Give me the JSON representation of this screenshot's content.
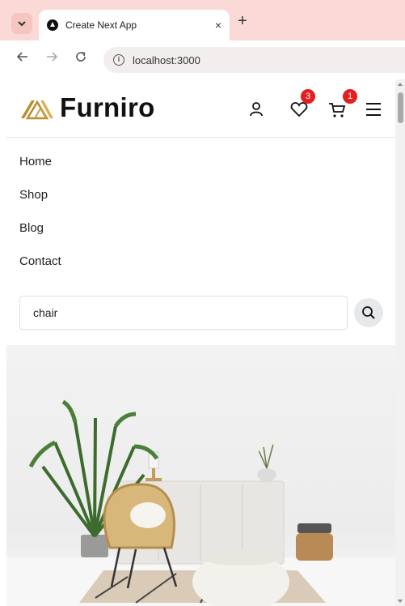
{
  "browser": {
    "tab_title": "Create Next App",
    "tab_close": "×",
    "new_tab": "+",
    "url": "localhost:3000",
    "info": "i"
  },
  "site": {
    "logo_text": "Furniro",
    "wishlist_count": "3",
    "cart_count": "1",
    "menu": [
      "Home",
      "Shop",
      "Blog",
      "Contact"
    ],
    "search": {
      "value": "chair"
    }
  },
  "colors": {
    "brand_gold": "#b88e2f",
    "badge_red": "#e51f1f",
    "tabbar": "#fbd9d6"
  },
  "icons": [
    "chevron-down-icon",
    "back-arrow-icon",
    "forward-arrow-icon",
    "reload-icon",
    "info-icon",
    "user-icon",
    "heart-icon",
    "cart-icon",
    "hamburger-menu-icon",
    "search-icon"
  ]
}
